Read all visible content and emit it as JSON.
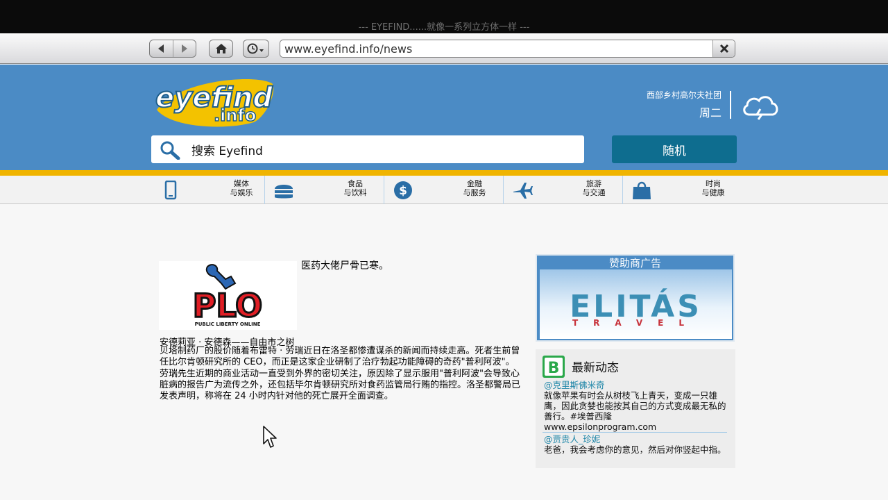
{
  "window": {
    "title": "--- EYEFIND......就像一系列立方体一样 ---"
  },
  "browser": {
    "back_icon": "back-arrow-icon",
    "forward_icon": "forward-arrow-icon",
    "home_icon": "home-icon",
    "history_icon": "clock-icon",
    "url": "www.eyefind.info/news",
    "clear_icon": "close-icon"
  },
  "header": {
    "logo_line1": "eyefind",
    "logo_line2": ".info",
    "location": "西部乡村高尔夫社团",
    "day": "周二",
    "weather_icon": "cloud-lightning-icon",
    "search_placeholder": "搜索 Eyefind",
    "random_label": "随机",
    "colors": {
      "header_bg": "#4b8bc5",
      "stripe": "#f0b400",
      "button": "#0e6d8f"
    }
  },
  "categories": [
    {
      "icon": "phone-icon",
      "line1": "媒体",
      "line2": "与娱乐"
    },
    {
      "icon": "burger-icon",
      "line1": "食品",
      "line2": "与饮料"
    },
    {
      "icon": "dollar-icon",
      "line1": "金融",
      "line2": "与服务"
    },
    {
      "icon": "plane-icon",
      "line1": "旅游",
      "line2": "与交通"
    },
    {
      "icon": "shopping-bag-icon",
      "line1": "时尚",
      "line2": "与健康"
    }
  ],
  "article": {
    "image_logo_text": "PLO",
    "image_caption": "PUBLIC LIBERTY ONLINE",
    "headline": "医药大佬尸骨已寒。",
    "byline": "安德莉亚 · 安德森——自由市之树",
    "body": "贝塔制药厂的股价随着布雷特 · 劳瑞近日在洛圣都惨遭谋杀的新闻而持续走高。死者生前曾任比尔肯顿研究所的 CEO，而正是这家企业研制了治疗勃起功能障碍的奇药\"普利阿波\"。劳瑞先生近期的商业活动一直受到外界的密切关注，原因除了显示服用\"普利阿波\"会导致心脏病的报告广为流传之外，还包括毕尔肯顿研究所对食药监管局行贿的指控。洛圣都警局已发表声明，称将在 24 小时内针对他的死亡展开全面调查。"
  },
  "sponsor": {
    "title": "赞助商广告",
    "brand": "ELITÁS",
    "brand_sub": "TRAVEL"
  },
  "feed": {
    "icon": "bleeter-icon",
    "title": "最新动态",
    "entries": [
      {
        "handle": "@克里斯佛米奇",
        "text": "就像苹果有时会从树枝飞上青天，变成一只雄鹰，因此贪婪也能按其自己的方式变成最无私的善行。#埃普西隆",
        "link": "www.epsilonprogram.com"
      },
      {
        "handle": "@贾贵人_珍妮",
        "text": "老爸，我会考虑你的意见，然后对你竖起中指。"
      }
    ]
  }
}
